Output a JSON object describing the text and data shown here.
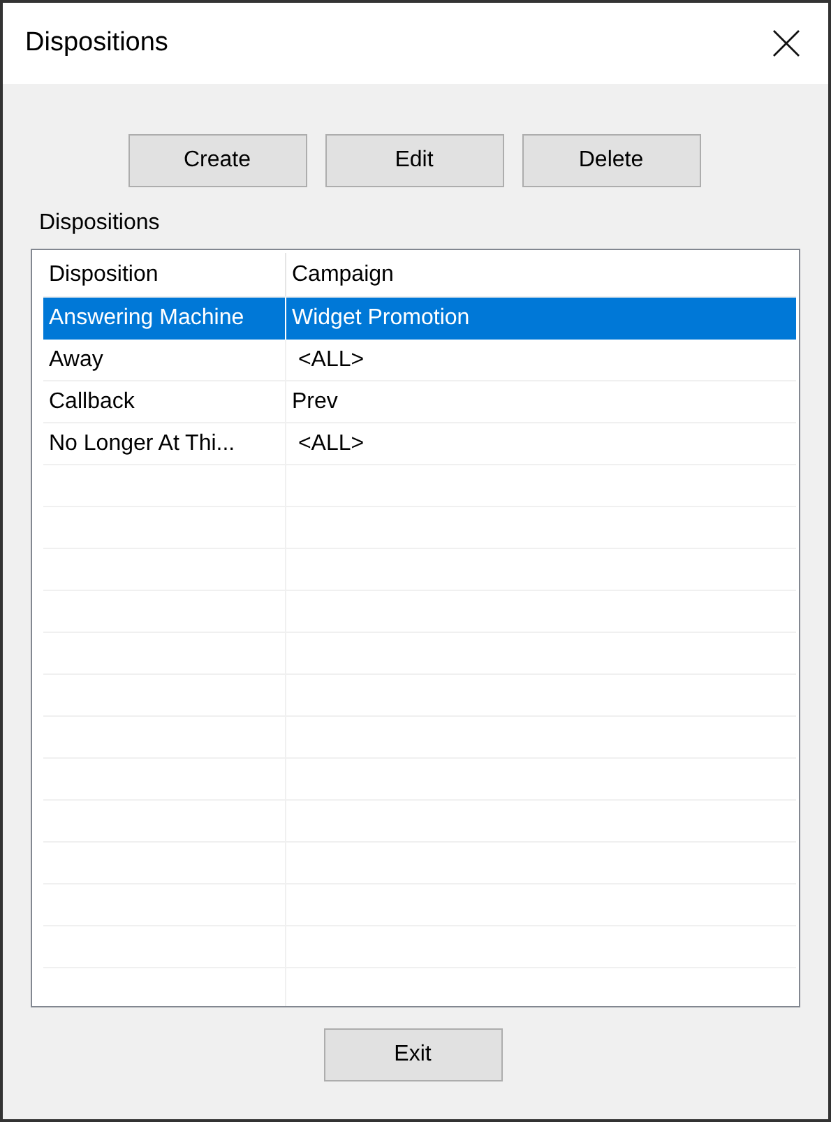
{
  "window": {
    "title": "Dispositions"
  },
  "buttons": [
    "Create",
    "Edit",
    "Delete"
  ],
  "list_label": "Dispositions",
  "table": {
    "columns": [
      "Disposition",
      "Campaign"
    ],
    "rows": [
      {
        "cells": [
          "Answering Machine",
          "Widget Promotion"
        ],
        "selected": true
      },
      {
        "cells": [
          "Away",
          " <ALL>"
        ],
        "selected": false
      },
      {
        "cells": [
          "Callback",
          "Prev"
        ],
        "selected": false
      },
      {
        "cells": [
          "No Longer At Thi...",
          " <ALL>"
        ],
        "selected": false
      }
    ]
  },
  "footer_button": "Exit"
}
